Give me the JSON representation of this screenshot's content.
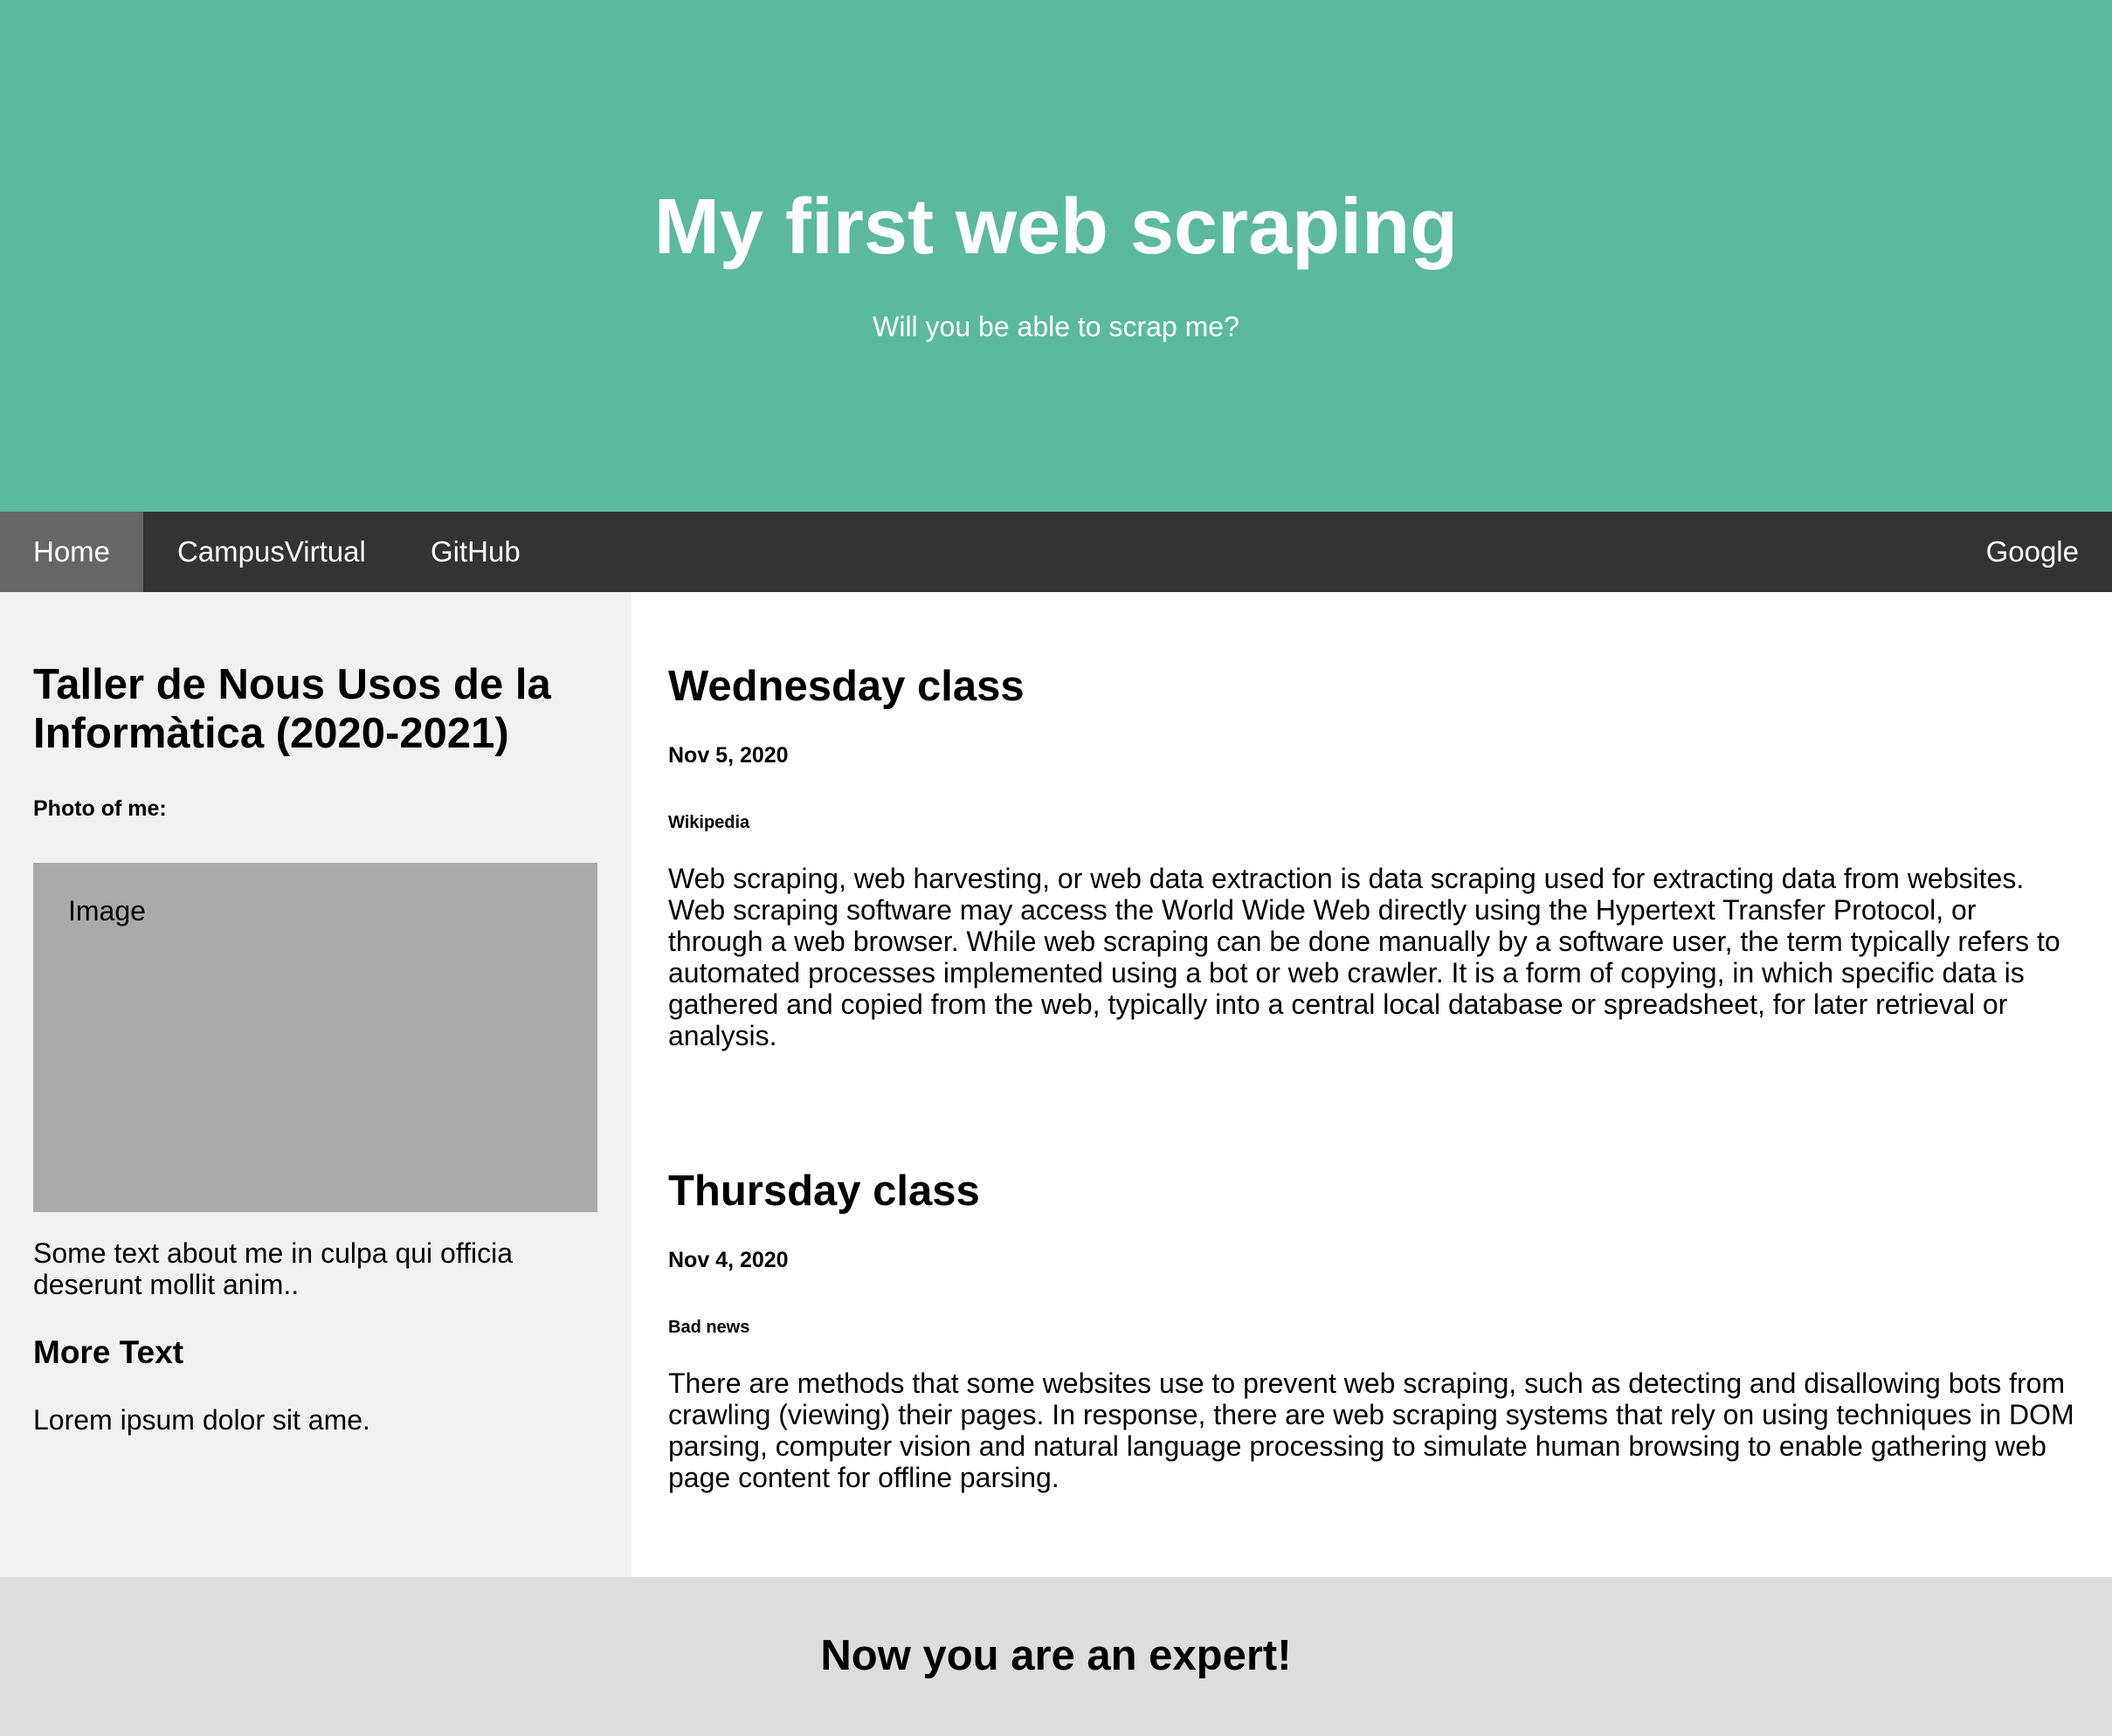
{
  "header": {
    "title": "My first web scraping",
    "subtitle": "Will you be able to scrap me?",
    "background_color": "#5bba9e"
  },
  "nav": {
    "items": [
      {
        "label": "Home",
        "active": true
      },
      {
        "label": "CampusVirtual",
        "active": false
      },
      {
        "label": "GitHub",
        "active": false
      }
    ],
    "right_item": {
      "label": "Google"
    },
    "background_color": "#333333",
    "active_color": "#666666"
  },
  "sidebar": {
    "title": "Taller de Nous Usos de la Informàtica (2020-2021)",
    "photo_label": "Photo of me:",
    "image_placeholder": "Image",
    "about_text": "Some text about me in culpa qui officia deserunt mollit anim..",
    "more_heading": "More Text",
    "more_text": "Lorem ipsum dolor sit ame."
  },
  "posts": [
    {
      "title": "Wednesday class",
      "date": "Nov 5, 2020",
      "tag": "Wikipedia",
      "text": "Web scraping, web harvesting, or web data extraction is data scraping used for extracting data from websites. Web scraping software may access the World Wide Web directly using the Hypertext Transfer Protocol, or through a web browser. While web scraping can be done manually by a software user, the term typically refers to automated processes implemented using a bot or web crawler. It is a form of copying, in which specific data is gathered and copied from the web, typically into a central local database or spreadsheet, for later retrieval or analysis."
    },
    {
      "title": "Thursday class",
      "date": "Nov 4, 2020",
      "tag": "Bad news",
      "text": "There are methods that some websites use to prevent web scraping, such as detecting and disallowing bots from crawling (viewing) their pages. In response, there are web scraping systems that rely on using techniques in DOM parsing, computer vision and natural language processing to simulate human browsing to enable gathering web page content for offline parsing."
    }
  ],
  "footer": {
    "text": "Now you are an expert!"
  }
}
